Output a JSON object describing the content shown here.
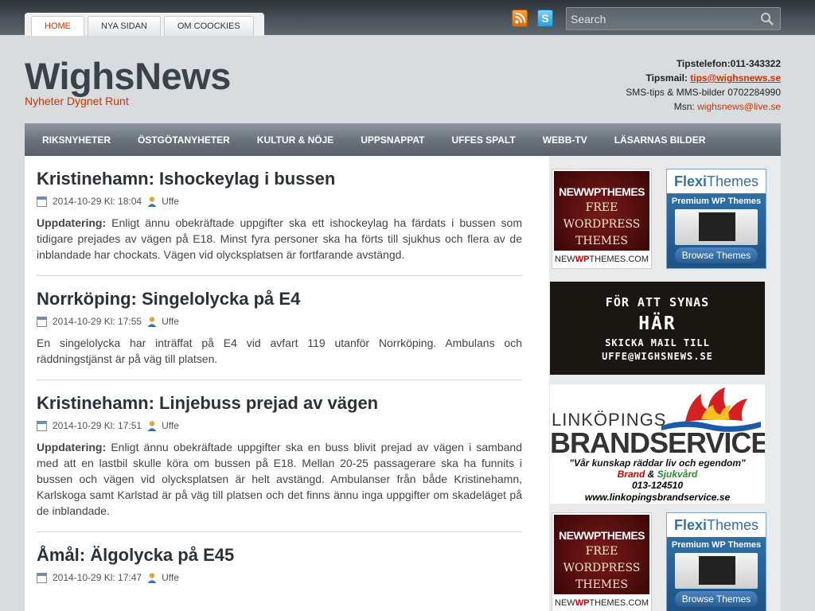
{
  "top_tabs": [
    "HOME",
    "NYA SIDAN",
    "OM COOCKIES"
  ],
  "search": {
    "placeholder": "Search"
  },
  "site": {
    "title": "WighsNews",
    "tagline": "Nyheter Dygnet Runt"
  },
  "contact": {
    "phone_label": "Tipstelefon:011-343322",
    "mail_label": "Tipsmail:",
    "mail": "tips@wighsnews.se",
    "sms": "SMS-tips & MMS-bilder 0702284990",
    "msn_label": "Msn:",
    "msn": "wighsnews@live.se"
  },
  "nav": [
    "RIKSNYHETER",
    "ÖSTGÖTANYHETER",
    "KULTUR & NÖJE",
    "UPPSNAPPAT",
    "UFFES SPALT",
    "WEBB-TV",
    "LÄSARNAS BILDER"
  ],
  "posts": [
    {
      "title": "Kristinehamn: Ishockeylag i bussen",
      "date": "2014-10-29 Kl: 18:04",
      "author": "Uffe",
      "lead": "Uppdatering:",
      "text": " Enligt ännu obekräftade uppgifter ska ett ishockeylag ha färdats i bussen som tidigare prejades av vägen på E18. Minst fyra personer ska ha förts till sjukhus och flera av de inblandade har chockats. Vägen vid olycksplatsen är fortfarande avstängd."
    },
    {
      "title": "Norrköping: Singelolycka på E4",
      "date": "2014-10-29 Kl: 17:55",
      "author": "Uffe",
      "lead": "",
      "text": "En singelolycka har inträffat på E4 vid avfart 119 utanför Norrköping. Ambulans och räddningstjänst är på väg till platsen."
    },
    {
      "title": "Kristinehamn: Linjebuss prejad av vägen",
      "date": "2014-10-29 Kl: 17:51",
      "author": "Uffe",
      "lead": "Uppdatering:",
      "text": " Enligt ännu obekräftade uppgifter ska en buss blivit prejad av vägen i samband med att en lastbil skulle köra om bussen på E18.  Mellan 20-25 passagerare ska ha funnits i bussen och vägen vid olycksplatsen är helt avstängd. Ambulanser från både Kristinehamn, Karlskoga samt Karlstad är på väg till platsen och det finns ännu inga uppgifter om skadeläget på de inblandade."
    },
    {
      "title": "Åmål: Älgolycka på E45",
      "date": "2014-10-29 Kl: 17:47",
      "author": "Uffe",
      "lead": "",
      "text": ""
    }
  ],
  "ads": {
    "nwp": {
      "logo": "NEWWPTHEMES",
      "tag1": "FREE",
      "tag2": "WORDPRESS",
      "tag3": "THEMES",
      "url_a": "NEW",
      "url_b": "WP",
      "url_c": "THEMES.COM"
    },
    "flexi": {
      "logo_a": "Flexi",
      "logo_b": "Themes",
      "premium": "Premium WP Themes",
      "button": "Browse Themes"
    },
    "synas": {
      "l1": "FÖR ATT SYNAS",
      "l2": "HÄR",
      "l3": "SKICKA MAIL TILL",
      "l4": "UFFE@WIGHSNEWS.SE"
    },
    "brand": {
      "city": "LINKÖPINGS",
      "name": "BRANDSERVICE",
      "slogan": "\"Vår kunskap räddar liv och egendom\"",
      "s1": "Brand",
      "amp": " & ",
      "s2": "Sjukvård",
      "phone": "013-124510",
      "web": "www.linkopingsbrandservice.se"
    }
  },
  "colors": {
    "accent": "#cc3300",
    "nav_bg": "#6b747c",
    "title": "#3a434b"
  }
}
